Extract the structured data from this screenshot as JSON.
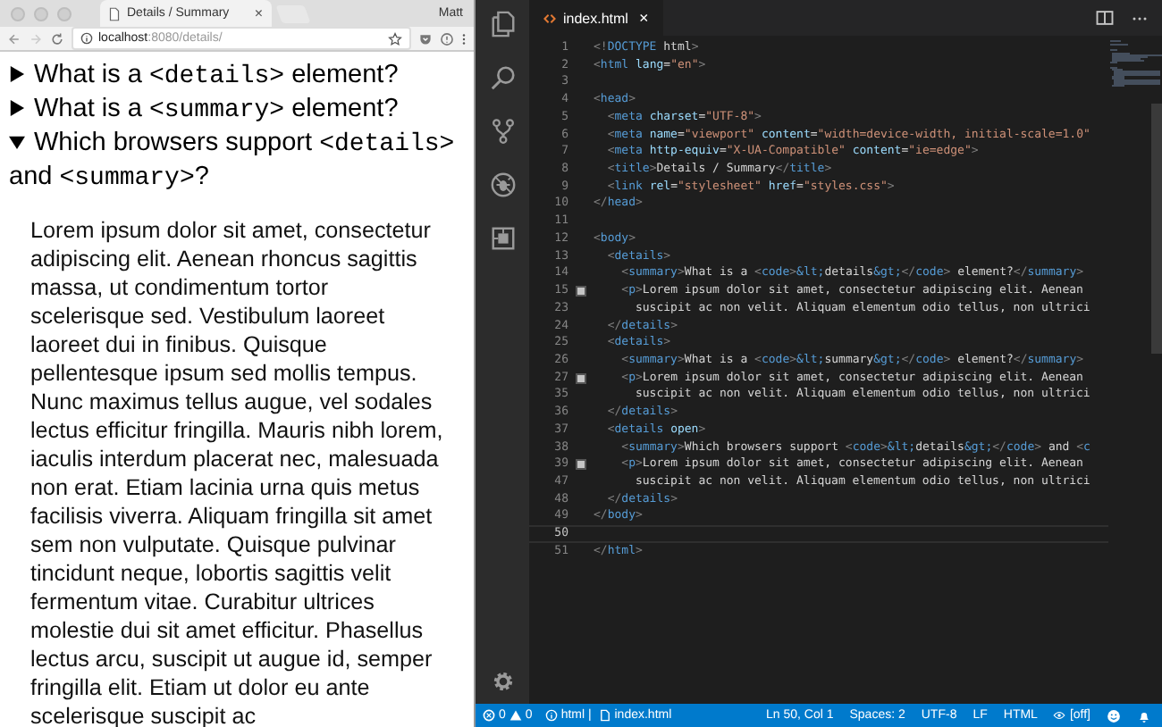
{
  "browser": {
    "tab": {
      "title": "Details / Summary",
      "close": "×"
    },
    "profile": "Matt",
    "address": {
      "host": "localhost",
      "path": ":8080/details/"
    },
    "details": [
      {
        "open": false,
        "summary": [
          {
            "kind": "text",
            "text": "What is a "
          },
          {
            "kind": "code",
            "text": "<details>"
          },
          {
            "kind": "text",
            "text": " element?"
          }
        ]
      },
      {
        "open": false,
        "summary": [
          {
            "kind": "text",
            "text": "What is a "
          },
          {
            "kind": "code",
            "text": "<summary>"
          },
          {
            "kind": "text",
            "text": " element?"
          }
        ]
      },
      {
        "open": true,
        "summary": [
          {
            "kind": "text",
            "text": "Which browsers support "
          },
          {
            "kind": "code",
            "text": "<details>"
          },
          {
            "kind": "text",
            "text": " and "
          },
          {
            "kind": "code",
            "text": "<summary>"
          },
          {
            "kind": "text",
            "text": "?"
          }
        ],
        "body": "Lorem ipsum dolor sit amet, consectetur adipiscing elit. Aenean rhoncus sagittis massa, ut condimentum tortor scelerisque sed. Vestibulum laoreet laoreet dui in finibus. Quisque pellentesque ipsum sed mollis tempus. Nunc maximus tellus augue, vel sodales lectus efficitur fringilla. Mauris nibh lorem, iaculis interdum placerat nec, malesuada non erat. Etiam lacinia urna quis metus facilisis viverra. Aliquam fringilla sit amet sem non vulputate. Quisque pulvinar tincidunt neque, lobortis sagittis velit fermentum vitae. Curabitur ultrices molestie dui sit amet efficitur. Phasellus lectus arcu, suscipit ut augue id, semper fringilla elit. Etiam ut dolor eu ante scelerisque suscipit ac"
      }
    ]
  },
  "editor": {
    "tab": {
      "title": "index.html",
      "close": "×"
    },
    "lines": [
      {
        "number": "1",
        "tokens": [
          {
            "kind": "punct",
            "text": "<!"
          },
          {
            "kind": "tag",
            "text": "DOCTYPE"
          },
          {
            "kind": "text",
            "text": " html"
          },
          {
            "kind": "punct",
            "text": ">"
          }
        ]
      },
      {
        "number": "2",
        "tokens": [
          {
            "kind": "punct",
            "text": "<"
          },
          {
            "kind": "tag",
            "text": "html"
          },
          {
            "kind": "attr",
            "text": " lang"
          },
          {
            "kind": "text",
            "text": "="
          },
          {
            "kind": "str",
            "text": "\"en\""
          },
          {
            "kind": "punct",
            "text": ">"
          }
        ]
      },
      {
        "number": "3"
      },
      {
        "number": "4",
        "tokens": [
          {
            "kind": "punct",
            "text": "<"
          },
          {
            "kind": "tag",
            "text": "head"
          },
          {
            "kind": "punct",
            "text": ">"
          }
        ]
      },
      {
        "number": "5",
        "tokens": [
          {
            "kind": "punct",
            "text": "  <"
          },
          {
            "kind": "tag",
            "text": "meta"
          },
          {
            "kind": "attr",
            "text": " charset"
          },
          {
            "kind": "text",
            "text": "="
          },
          {
            "kind": "str",
            "text": "\"UTF-8\""
          },
          {
            "kind": "punct",
            "text": ">"
          }
        ]
      },
      {
        "number": "6",
        "tokens": [
          {
            "kind": "punct",
            "text": "  <"
          },
          {
            "kind": "tag",
            "text": "meta"
          },
          {
            "kind": "attr",
            "text": " name"
          },
          {
            "kind": "text",
            "text": "="
          },
          {
            "kind": "str",
            "text": "\"viewport\""
          },
          {
            "kind": "attr",
            "text": " content"
          },
          {
            "kind": "text",
            "text": "="
          },
          {
            "kind": "str",
            "text": "\"width=device-width, initial-scale=1.0\""
          }
        ]
      },
      {
        "number": "7",
        "tokens": [
          {
            "kind": "punct",
            "text": "  <"
          },
          {
            "kind": "tag",
            "text": "meta"
          },
          {
            "kind": "attr",
            "text": " http-equiv"
          },
          {
            "kind": "text",
            "text": "="
          },
          {
            "kind": "str",
            "text": "\"X-UA-Compatible\""
          },
          {
            "kind": "attr",
            "text": " content"
          },
          {
            "kind": "text",
            "text": "="
          },
          {
            "kind": "str",
            "text": "\"ie=edge\""
          },
          {
            "kind": "punct",
            "text": ">"
          }
        ]
      },
      {
        "number": "8",
        "tokens": [
          {
            "kind": "punct",
            "text": "  <"
          },
          {
            "kind": "tag",
            "text": "title"
          },
          {
            "kind": "punct",
            "text": ">"
          },
          {
            "kind": "text",
            "text": "Details / Summary"
          },
          {
            "kind": "punct",
            "text": "</"
          },
          {
            "kind": "tag",
            "text": "title"
          },
          {
            "kind": "punct",
            "text": ">"
          }
        ]
      },
      {
        "number": "9",
        "tokens": [
          {
            "kind": "punct",
            "text": "  <"
          },
          {
            "kind": "tag",
            "text": "link"
          },
          {
            "kind": "attr",
            "text": " rel"
          },
          {
            "kind": "text",
            "text": "="
          },
          {
            "kind": "str",
            "text": "\"stylesheet\""
          },
          {
            "kind": "attr",
            "text": " href"
          },
          {
            "kind": "text",
            "text": "="
          },
          {
            "kind": "str",
            "text": "\"styles.css\""
          },
          {
            "kind": "punct",
            "text": ">"
          }
        ]
      },
      {
        "number": "10",
        "tokens": [
          {
            "kind": "punct",
            "text": "</"
          },
          {
            "kind": "tag",
            "text": "head"
          },
          {
            "kind": "punct",
            "text": ">"
          }
        ]
      },
      {
        "number": "11"
      },
      {
        "number": "12",
        "tokens": [
          {
            "kind": "punct",
            "text": "<"
          },
          {
            "kind": "tag",
            "text": "body"
          },
          {
            "kind": "punct",
            "text": ">"
          }
        ]
      },
      {
        "number": "13",
        "tokens": [
          {
            "kind": "punct",
            "text": "  <"
          },
          {
            "kind": "tag",
            "text": "details"
          },
          {
            "kind": "punct",
            "text": ">"
          }
        ]
      },
      {
        "number": "14",
        "tokens": [
          {
            "kind": "punct",
            "text": "    <"
          },
          {
            "kind": "tag",
            "text": "summary"
          },
          {
            "kind": "punct",
            "text": ">"
          },
          {
            "kind": "text",
            "text": "What is a "
          },
          {
            "kind": "punct",
            "text": "<"
          },
          {
            "kind": "tag",
            "text": "code"
          },
          {
            "kind": "punct",
            "text": ">"
          },
          {
            "kind": "tag",
            "text": "&lt;"
          },
          {
            "kind": "text",
            "text": "details"
          },
          {
            "kind": "tag",
            "text": "&gt;"
          },
          {
            "kind": "punct",
            "text": "</"
          },
          {
            "kind": "tag",
            "text": "code"
          },
          {
            "kind": "punct",
            "text": ">"
          },
          {
            "kind": "text",
            "text": " element?"
          },
          {
            "kind": "punct",
            "text": "</"
          },
          {
            "kind": "tag",
            "text": "summary"
          },
          {
            "kind": "punct",
            "text": ">"
          }
        ]
      },
      {
        "number": "15",
        "folded": true,
        "tokens": [
          {
            "kind": "punct",
            "text": "    <"
          },
          {
            "kind": "tag",
            "text": "p"
          },
          {
            "kind": "punct",
            "text": ">"
          },
          {
            "kind": "text",
            "text": "Lorem ipsum dolor sit amet, consectetur adipiscing elit. Aenean"
          }
        ]
      },
      {
        "number": "23",
        "tokens": [
          {
            "kind": "text",
            "text": "      suscipit ac non velit. Aliquam elementum odio tellus, non ultrici"
          }
        ]
      },
      {
        "number": "24",
        "tokens": [
          {
            "kind": "punct",
            "text": "  </"
          },
          {
            "kind": "tag",
            "text": "details"
          },
          {
            "kind": "punct",
            "text": ">"
          }
        ]
      },
      {
        "number": "25",
        "tokens": [
          {
            "kind": "punct",
            "text": "  <"
          },
          {
            "kind": "tag",
            "text": "details"
          },
          {
            "kind": "punct",
            "text": ">"
          }
        ]
      },
      {
        "number": "26",
        "tokens": [
          {
            "kind": "punct",
            "text": "    <"
          },
          {
            "kind": "tag",
            "text": "summary"
          },
          {
            "kind": "punct",
            "text": ">"
          },
          {
            "kind": "text",
            "text": "What is a "
          },
          {
            "kind": "punct",
            "text": "<"
          },
          {
            "kind": "tag",
            "text": "code"
          },
          {
            "kind": "punct",
            "text": ">"
          },
          {
            "kind": "tag",
            "text": "&lt;"
          },
          {
            "kind": "text",
            "text": "summary"
          },
          {
            "kind": "tag",
            "text": "&gt;"
          },
          {
            "kind": "punct",
            "text": "</"
          },
          {
            "kind": "tag",
            "text": "code"
          },
          {
            "kind": "punct",
            "text": ">"
          },
          {
            "kind": "text",
            "text": " element?"
          },
          {
            "kind": "punct",
            "text": "</"
          },
          {
            "kind": "tag",
            "text": "summary"
          },
          {
            "kind": "punct",
            "text": ">"
          }
        ]
      },
      {
        "number": "27",
        "folded": true,
        "tokens": [
          {
            "kind": "punct",
            "text": "    <"
          },
          {
            "kind": "tag",
            "text": "p"
          },
          {
            "kind": "punct",
            "text": ">"
          },
          {
            "kind": "text",
            "text": "Lorem ipsum dolor sit amet, consectetur adipiscing elit. Aenean"
          }
        ]
      },
      {
        "number": "35",
        "tokens": [
          {
            "kind": "text",
            "text": "      suscipit ac non velit. Aliquam elementum odio tellus, non ultrici"
          }
        ]
      },
      {
        "number": "36",
        "tokens": [
          {
            "kind": "punct",
            "text": "  </"
          },
          {
            "kind": "tag",
            "text": "details"
          },
          {
            "kind": "punct",
            "text": ">"
          }
        ]
      },
      {
        "number": "37",
        "tokens": [
          {
            "kind": "punct",
            "text": "  <"
          },
          {
            "kind": "tag",
            "text": "details"
          },
          {
            "kind": "attr",
            "text": " open"
          },
          {
            "kind": "punct",
            "text": ">"
          }
        ]
      },
      {
        "number": "38",
        "tokens": [
          {
            "kind": "punct",
            "text": "    <"
          },
          {
            "kind": "tag",
            "text": "summary"
          },
          {
            "kind": "punct",
            "text": ">"
          },
          {
            "kind": "text",
            "text": "Which browsers support "
          },
          {
            "kind": "punct",
            "text": "<"
          },
          {
            "kind": "tag",
            "text": "code"
          },
          {
            "kind": "punct",
            "text": ">"
          },
          {
            "kind": "tag",
            "text": "&lt;"
          },
          {
            "kind": "text",
            "text": "details"
          },
          {
            "kind": "tag",
            "text": "&gt;"
          },
          {
            "kind": "punct",
            "text": "</"
          },
          {
            "kind": "tag",
            "text": "code"
          },
          {
            "kind": "punct",
            "text": ">"
          },
          {
            "kind": "text",
            "text": " and "
          },
          {
            "kind": "punct",
            "text": "<"
          },
          {
            "kind": "tag",
            "text": "c"
          }
        ]
      },
      {
        "number": "39",
        "folded": true,
        "tokens": [
          {
            "kind": "punct",
            "text": "    <"
          },
          {
            "kind": "tag",
            "text": "p"
          },
          {
            "kind": "punct",
            "text": ">"
          },
          {
            "kind": "text",
            "text": "Lorem ipsum dolor sit amet, consectetur adipiscing elit. Aenean"
          }
        ]
      },
      {
        "number": "47",
        "tokens": [
          {
            "kind": "text",
            "text": "      suscipit ac non velit. Aliquam elementum odio tellus, non ultrici"
          }
        ]
      },
      {
        "number": "48",
        "tokens": [
          {
            "kind": "punct",
            "text": "  </"
          },
          {
            "kind": "tag",
            "text": "details"
          },
          {
            "kind": "punct",
            "text": ">"
          }
        ]
      },
      {
        "number": "49",
        "tokens": [
          {
            "kind": "punct",
            "text": "</"
          },
          {
            "kind": "tag",
            "text": "body"
          },
          {
            "kind": "punct",
            "text": ">"
          }
        ]
      },
      {
        "number": "50",
        "current": true
      },
      {
        "number": "51",
        "tokens": [
          {
            "kind": "punct",
            "text": "</"
          },
          {
            "kind": "tag",
            "text": "html"
          },
          {
            "kind": "punct",
            "text": ">"
          }
        ]
      }
    ]
  },
  "status_bar": {
    "errors": "0",
    "warnings": "0",
    "language_info": "html | ",
    "file": "index.html",
    "position": "Ln 50, Col 1",
    "indent": "Spaces: 2",
    "encoding": "UTF-8",
    "eol": "LF",
    "mode": "HTML",
    "preview": "[off]"
  }
}
